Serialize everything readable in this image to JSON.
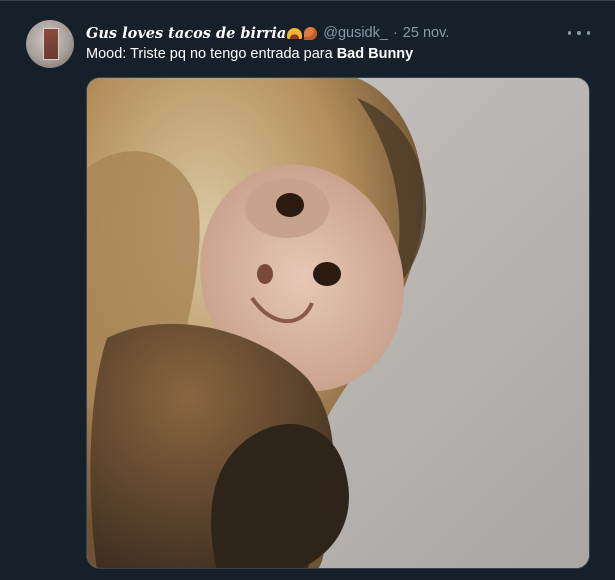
{
  "tweet": {
    "display_name": "Gus loves tacos de birria",
    "display_name_emojis": [
      "taco",
      "poultry-leg"
    ],
    "handle": "@gusidk_",
    "separator": "·",
    "timestamp": "25 nov.",
    "text_prefix": "Mood: Triste pq no tengo entrada para ",
    "text_bold": "Bad Bunny",
    "media": {
      "alt": "",
      "subject": "capuchin monkey lying on grey blanket"
    }
  },
  "colors": {
    "background": "#15202b",
    "primary_text": "#ffffff",
    "secondary_text": "#8b98a5",
    "border": "#38444d"
  },
  "icons": {
    "more": "more-horizontal-icon"
  }
}
